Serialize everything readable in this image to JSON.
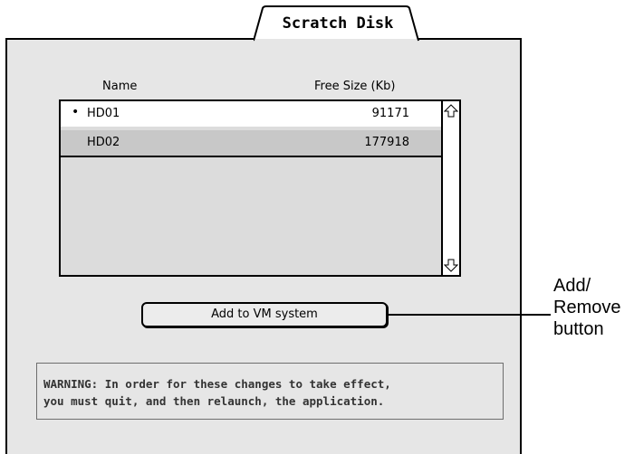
{
  "panel": {
    "tab_label": "Scratch Disk",
    "columns": {
      "name": "Name",
      "free_size": "Free Size (Kb)"
    },
    "disks": [
      {
        "bullet": "•",
        "name": "HD01",
        "free_size": "91171"
      },
      {
        "bullet": "",
        "name": "HD02",
        "free_size": "177918"
      }
    ],
    "add_button_label": "Add to VM system",
    "warning": {
      "line1": "WARNING: In order for these changes to take effect,",
      "line2": "you must quit, and then relaunch, the application."
    }
  },
  "callout": {
    "line1": "Add/",
    "line2": "Remove",
    "line3": "button"
  },
  "icons": {
    "scroll_up": "arrow-up-icon",
    "scroll_down": "arrow-down-icon"
  },
  "colors": {
    "panel_bg": "#e6e6e6",
    "selected_row": "#c8c8c8"
  }
}
